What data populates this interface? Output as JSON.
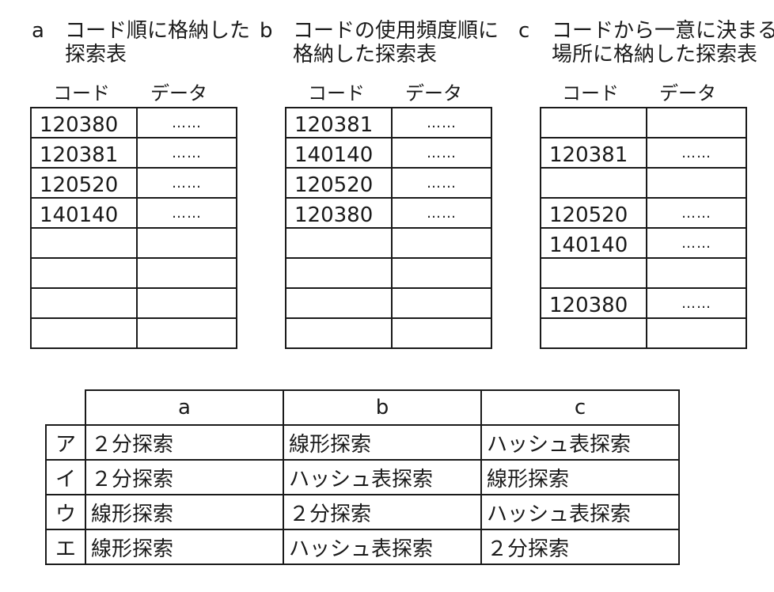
{
  "captions": [
    {
      "letter": "a",
      "line1": "コード順に格納した",
      "line2": "探索表"
    },
    {
      "letter": "b",
      "line1": "コードの使用頻度順に",
      "line2": "格納した探索表"
    },
    {
      "letter": "c",
      "line1": "コードから一意に決まる",
      "line2": "場所に格納した探索表"
    }
  ],
  "table_headers": {
    "code": "コード",
    "data": "データ"
  },
  "tables": [
    {
      "rows": [
        {
          "code": "120380",
          "data": "……"
        },
        {
          "code": "120381",
          "data": "……"
        },
        {
          "code": "120520",
          "data": "……"
        },
        {
          "code": "140140",
          "data": "……"
        },
        {
          "code": "",
          "data": ""
        },
        {
          "code": "",
          "data": ""
        },
        {
          "code": "",
          "data": ""
        },
        {
          "code": "",
          "data": ""
        }
      ]
    },
    {
      "rows": [
        {
          "code": "120381",
          "data": "……"
        },
        {
          "code": "140140",
          "data": "……"
        },
        {
          "code": "120520",
          "data": "……"
        },
        {
          "code": "120380",
          "data": "……"
        },
        {
          "code": "",
          "data": ""
        },
        {
          "code": "",
          "data": ""
        },
        {
          "code": "",
          "data": ""
        },
        {
          "code": "",
          "data": ""
        }
      ]
    },
    {
      "rows": [
        {
          "code": "",
          "data": ""
        },
        {
          "code": "120381",
          "data": "……"
        },
        {
          "code": "",
          "data": ""
        },
        {
          "code": "120520",
          "data": "……"
        },
        {
          "code": "140140",
          "data": "……"
        },
        {
          "code": "",
          "data": ""
        },
        {
          "code": "120380",
          "data": "……"
        },
        {
          "code": "",
          "data": ""
        }
      ]
    }
  ],
  "answer_table": {
    "headers": [
      "a",
      "b",
      "c"
    ],
    "rows": [
      {
        "label": "ア",
        "cells": [
          "２分探索",
          "線形探索",
          "ハッシュ表探索"
        ]
      },
      {
        "label": "イ",
        "cells": [
          "２分探索",
          "ハッシュ表探索",
          "線形探索"
        ]
      },
      {
        "label": "ウ",
        "cells": [
          "線形探索",
          "２分探索",
          "ハッシュ表探索"
        ]
      },
      {
        "label": "エ",
        "cells": [
          "線形探索",
          "ハッシュ表探索",
          "２分探索"
        ]
      }
    ]
  }
}
